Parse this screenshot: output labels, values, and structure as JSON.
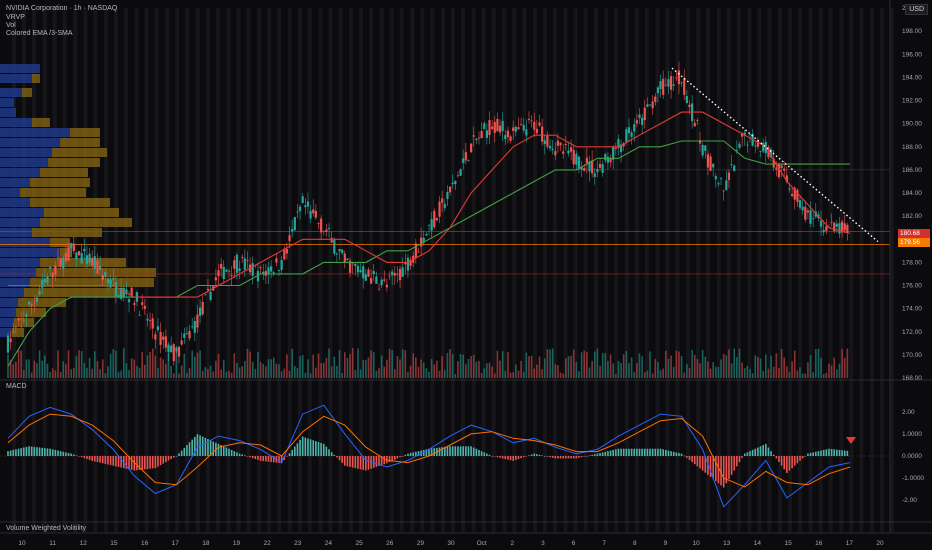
{
  "header": {
    "title": "NVIDIA Corporation · 1h · NASDAQ",
    "indicators": [
      "VRVP",
      "Vol",
      "Colored EMA /3-SMA"
    ]
  },
  "currency": "USD",
  "macd_label": "MACD",
  "vwv_label": "Volume Weighted Volitility",
  "price_tags": {
    "current": "180.68",
    "level": "179.56"
  },
  "colors": {
    "bg": "#0b0b0e",
    "up": "#26a69a",
    "down": "#ef5350",
    "ema_red": "#e53935",
    "sma_green": "#43a047",
    "macd_line": "#2962ff",
    "signal_line": "#ff6d00",
    "vp_blue": "#1e3a8a",
    "vp_gold": "#8b6914",
    "tag_orange": "#f57c00",
    "tag_red": "#d32f2f"
  },
  "chart_data": {
    "type": "line",
    "title": "NVIDIA Corporation · 1h · NASDAQ",
    "ylim": [
      168,
      200
    ],
    "y_ticks": [
      "200.00",
      "198.00",
      "196.00",
      "194.00",
      "192.00",
      "190.00",
      "188.00",
      "186.00",
      "184.00",
      "182.00",
      "180.00",
      "178.00",
      "176.00",
      "174.00",
      "172.00",
      "170.00",
      "168.00"
    ],
    "x_ticks": [
      "10",
      "11",
      "12",
      "15",
      "16",
      "17",
      "18",
      "19",
      "22",
      "23",
      "24",
      "25",
      "26",
      "29",
      "30",
      "Oct",
      "2",
      "3",
      "6",
      "7",
      "8",
      "9",
      "10",
      "13",
      "14",
      "15",
      "16",
      "17",
      "20"
    ],
    "series": [
      {
        "name": "Price",
        "values": [
          171,
          174,
          177,
          179,
          178,
          176,
          175,
          172,
          170,
          173,
          177,
          178,
          177,
          178,
          183,
          181,
          178,
          177,
          176,
          178,
          181,
          184,
          188,
          190,
          189,
          190,
          188,
          187,
          186,
          188,
          190,
          193,
          194,
          188,
          184,
          189,
          188,
          185,
          182,
          181,
          180.68
        ]
      },
      {
        "name": "EMA",
        "values": [
          176,
          176,
          176,
          176,
          176,
          176,
          175,
          175,
          175,
          175,
          176,
          177,
          178,
          179,
          180,
          180,
          180,
          179,
          178,
          178,
          179,
          181,
          184,
          186,
          188,
          189,
          189,
          188,
          188,
          188,
          189,
          190,
          191,
          191,
          190,
          189,
          188,
          185,
          183,
          181,
          180.5
        ]
      },
      {
        "name": "SMA",
        "values": [
          169,
          172,
          174,
          175,
          175,
          175,
          175,
          175,
          175,
          176,
          176,
          176,
          177,
          177,
          177,
          178,
          178,
          178,
          179,
          179,
          180,
          181,
          182,
          183,
          184,
          185,
          186,
          186,
          187,
          187,
          188,
          188,
          188.5,
          188.5,
          188.5,
          187,
          186.5,
          186.5,
          186.5,
          186.5,
          186.5
        ]
      }
    ],
    "levels": [
      180.68,
      179.56,
      177.0,
      186.0,
      170.0
    ],
    "trendline": {
      "from": [
        10,
        194.8
      ],
      "to": [
        17,
        179.8
      ]
    },
    "macd": {
      "ylim": [
        -2.9,
        2.9
      ],
      "y_ticks": [
        "2.00",
        "1.0000",
        "0.0000",
        "-1.0000",
        "-2.00"
      ],
      "macd_values": [
        0.8,
        1.8,
        2.2,
        1.9,
        1.2,
        0.3,
        -0.9,
        -1.7,
        -1.3,
        0.4,
        0.9,
        0.7,
        0.3,
        -0.3,
        1.9,
        2.3,
        1.0,
        -0.2,
        -0.5,
        -0.2,
        0.3,
        0.9,
        1.4,
        1.1,
        0.6,
        0.8,
        0.4,
        0.1,
        0.3,
        0.9,
        1.4,
        1.9,
        1.8,
        0.3,
        -2.3,
        -1.3,
        -0.2,
        -1.9,
        -1.2,
        -0.5,
        -0.3
      ],
      "signal_values": [
        0.6,
        1.4,
        1.9,
        1.8,
        1.4,
        0.7,
        -0.3,
        -1.2,
        -1.3,
        -0.5,
        0.4,
        0.6,
        0.5,
        0.0,
        1.1,
        1.8,
        1.4,
        0.4,
        -0.2,
        -0.3,
        0.0,
        0.5,
        1.0,
        1.1,
        0.8,
        0.7,
        0.5,
        0.2,
        0.2,
        0.6,
        1.1,
        1.6,
        1.7,
        0.9,
        -1.0,
        -1.4,
        -0.7,
        -1.2,
        -1.3,
        -0.8,
        -0.5
      ]
    }
  }
}
